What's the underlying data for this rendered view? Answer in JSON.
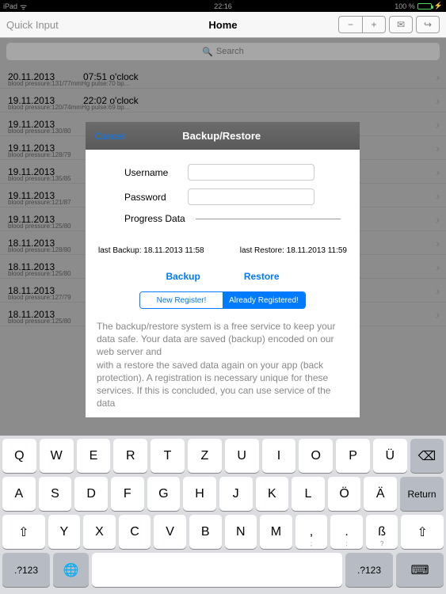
{
  "status": {
    "device": "iPad",
    "time": "22:16",
    "battery": "100 %"
  },
  "nav": {
    "left": "Quick Input",
    "title": "Home"
  },
  "search": {
    "placeholder": "Search"
  },
  "rows": [
    {
      "date": "20.11.2013",
      "time": "07:51 o'clock",
      "sub": "blood pressure:131/77mmHg pulse:70 bp..."
    },
    {
      "date": "19.11.2013",
      "time": "22:02 o'clock",
      "sub": "blood pressure:120/74mmHg pulse:69 bp..."
    },
    {
      "date": "19.11.2013",
      "time": "",
      "sub": "blood pressure:130/80"
    },
    {
      "date": "19.11.2013",
      "time": "",
      "sub": "blood pressure:128/79"
    },
    {
      "date": "19.11.2013",
      "time": "",
      "sub": "blood pressure:135/85"
    },
    {
      "date": "19.11.2013",
      "time": "",
      "sub": "blood pressure:121/87"
    },
    {
      "date": "19.11.2013",
      "time": "",
      "sub": "blood pressure:125/80"
    },
    {
      "date": "18.11.2013",
      "time": "",
      "sub": "blood pressure:128/80"
    },
    {
      "date": "18.11.2013",
      "time": "",
      "sub": "blood pressure:125/80"
    },
    {
      "date": "18.11.2013",
      "time": "",
      "sub": "blood pressure:127/79"
    },
    {
      "date": "18.11.2013",
      "time": "",
      "sub": "blood pressure:125/80"
    }
  ],
  "modal": {
    "cancel": "Cancel",
    "title": "Backup/Restore",
    "username_label": "Username",
    "password_label": "Password",
    "progress_label": "Progress Data",
    "last_backup": "last Backup: 18.11.2013 11:58",
    "last_restore": "last Restore: 18.11.2013 11:59",
    "backup_btn": "Backup",
    "restore_btn": "Restore",
    "new_register": "New Register!",
    "already_registered": "Already Registered!",
    "description": "The backup/restore system is a free service to keep your data safe. Your data are saved (backup) encoded on our web server and\nwith a restore the saved data again on your app (back protection). A registration is necessary unique for these services. If this is concluded, you can use service of the data"
  },
  "keyboard": {
    "row1": [
      "Q",
      "W",
      "E",
      "R",
      "T",
      "Z",
      "U",
      "I",
      "O",
      "P",
      "Ü"
    ],
    "row2": [
      "A",
      "S",
      "D",
      "F",
      "G",
      "H",
      "J",
      "K",
      "L",
      "Ö",
      "Ä"
    ],
    "row3": [
      "Y",
      "X",
      "C",
      "V",
      "B",
      "N",
      "M",
      ",",
      ".",
      "ß"
    ],
    "return": "Return",
    "sym": ".?123"
  }
}
